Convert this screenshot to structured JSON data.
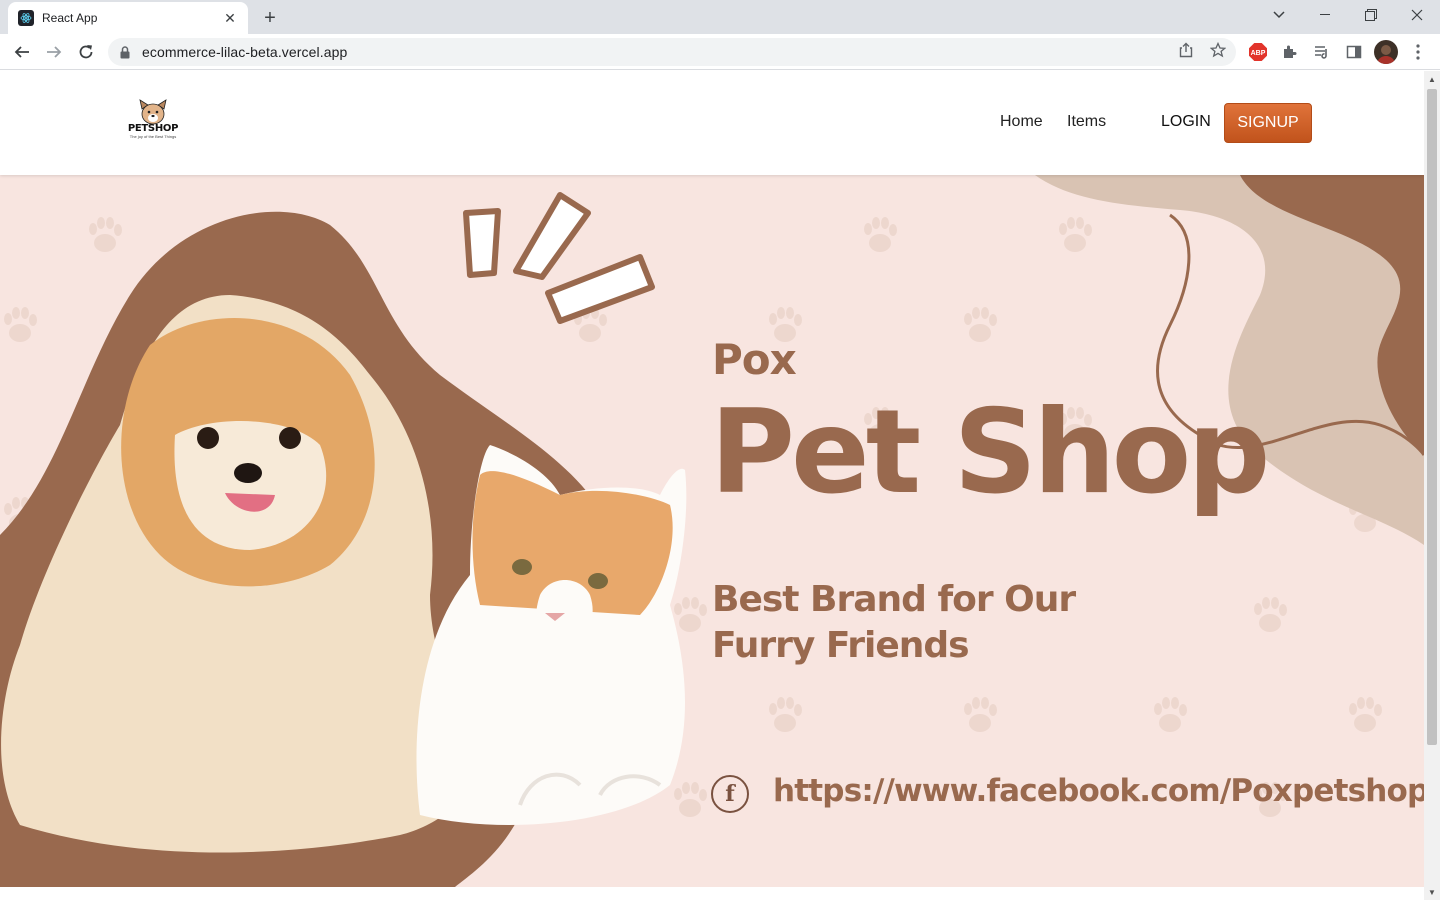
{
  "browser": {
    "tab_title": "React App",
    "url": "ecommerce-lilac-beta.vercel.app",
    "icons": [
      "react-favicon",
      "close-icon",
      "plus-icon",
      "chevron-down-icon",
      "minimize-icon",
      "restore-icon",
      "window-close-icon",
      "back-icon",
      "forward-icon",
      "reload-icon",
      "lock-icon",
      "share-icon",
      "star-icon",
      "adblock-icon",
      "puzzle-icon",
      "media-icon",
      "sidepanel-icon",
      "avatar",
      "kebab-menu-icon"
    ],
    "adblock_label": "ABP"
  },
  "header": {
    "logo_text": "PETSHOP",
    "logo_tagline": "The joy of the Best Things",
    "nav": [
      {
        "label": "Home"
      },
      {
        "label": "Items"
      }
    ],
    "login_label": "LOGIN",
    "signup_label": "SIGNUP"
  },
  "hero": {
    "brand_small": "Pox",
    "brand_large": "Pet Shop",
    "tagline": "Best Brand for Our Furry Friends",
    "facebook_glyph": "f",
    "facebook_url": "https://www.facebook.com/Poxpetshop",
    "colors": {
      "background": "#f8e5e0",
      "brown": "#99694e",
      "beige": "#d9c3b3",
      "signup": "#d2622a"
    }
  }
}
